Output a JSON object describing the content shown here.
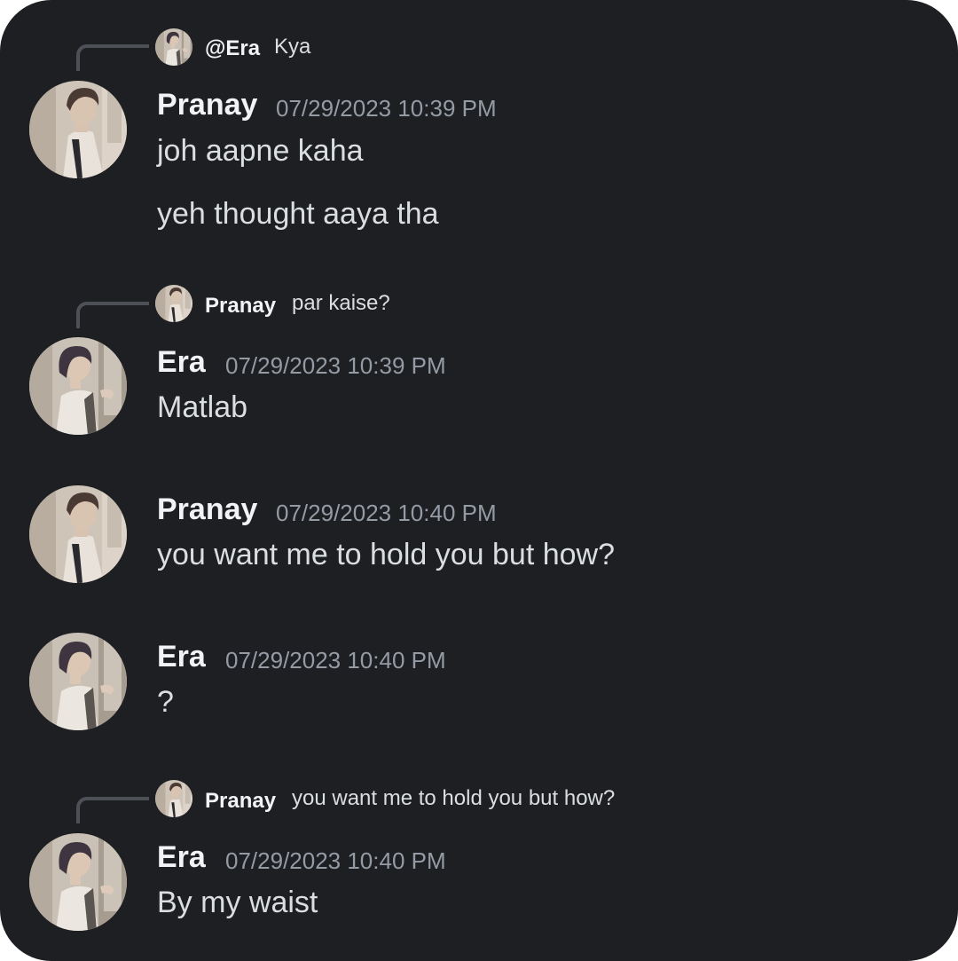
{
  "colors": {
    "background": "#1e1f23",
    "author": "#f2f3f5",
    "message_text": "#dbdee1",
    "timestamp": "#949ba4",
    "reply_line": "#4e5058"
  },
  "messages": [
    {
      "reply": {
        "name": "@Era",
        "text": "Kya",
        "avatar": "era-avatar"
      },
      "author": "Pranay",
      "avatar": "pranay-avatar",
      "timestamp": "07/29/2023 10:39 PM",
      "lines": [
        "joh aapne kaha",
        "yeh thought aaya tha"
      ]
    },
    {
      "reply": {
        "name": "Pranay",
        "text": "par kaise?",
        "avatar": "pranay-avatar"
      },
      "author": "Era",
      "avatar": "era-avatar",
      "timestamp": "07/29/2023 10:39 PM",
      "lines": [
        "Matlab"
      ]
    },
    {
      "author": "Pranay",
      "avatar": "pranay-avatar",
      "timestamp": "07/29/2023 10:40 PM",
      "lines": [
        "you want me to hold you but how?"
      ]
    },
    {
      "author": "Era",
      "avatar": "era-avatar",
      "timestamp": "07/29/2023 10:40 PM",
      "lines": [
        "?"
      ]
    },
    {
      "reply": {
        "name": "Pranay",
        "text": "you want me to hold you but how?",
        "avatar": "pranay-avatar"
      },
      "author": "Era",
      "avatar": "era-avatar",
      "timestamp": "07/29/2023 10:40 PM",
      "lines": [
        "By my waist"
      ]
    }
  ]
}
